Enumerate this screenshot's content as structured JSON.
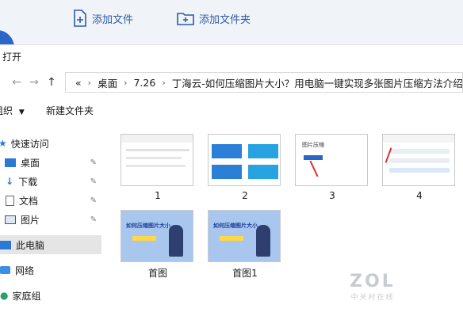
{
  "topbar": {
    "add_file": "添加文件",
    "add_folder": "添加文件夹"
  },
  "dialog": {
    "title": "打开",
    "address": {
      "overflow": "«",
      "segments": [
        "桌面",
        "7.26",
        "丁海云-如何压缩图片大小？用电脑一键实现多张图片压缩方法介绍"
      ]
    },
    "toolbar": {
      "organize": "组织",
      "new_folder": "新建文件夹"
    },
    "sidebar": {
      "items": [
        {
          "label": "快速访问",
          "icon": "star-icon"
        },
        {
          "label": "桌面",
          "icon": "desktop-icon"
        },
        {
          "label": "下载",
          "icon": "download-icon"
        },
        {
          "label": "文档",
          "icon": "document-icon"
        },
        {
          "label": "图片",
          "icon": "picture-icon"
        },
        {
          "label": "此电脑",
          "icon": "computer-icon"
        },
        {
          "label": "网络",
          "icon": "network-icon"
        },
        {
          "label": "家庭组",
          "icon": "homegroup-icon"
        }
      ]
    },
    "files": [
      {
        "name": "1"
      },
      {
        "name": "2"
      },
      {
        "name": "3",
        "thumb_text": "图片压缩"
      },
      {
        "name": "4"
      },
      {
        "name": "首图",
        "thumb_text": "如何压缩图片大小"
      },
      {
        "name": "首图1",
        "thumb_text": "如何压缩图片大小"
      }
    ]
  },
  "watermark": {
    "brand": "ZOL",
    "sub": "中关村在线"
  },
  "colors": {
    "accent": "#2e5ba8",
    "folder": "#f6cf5c",
    "selected": "#e5e5e5"
  }
}
